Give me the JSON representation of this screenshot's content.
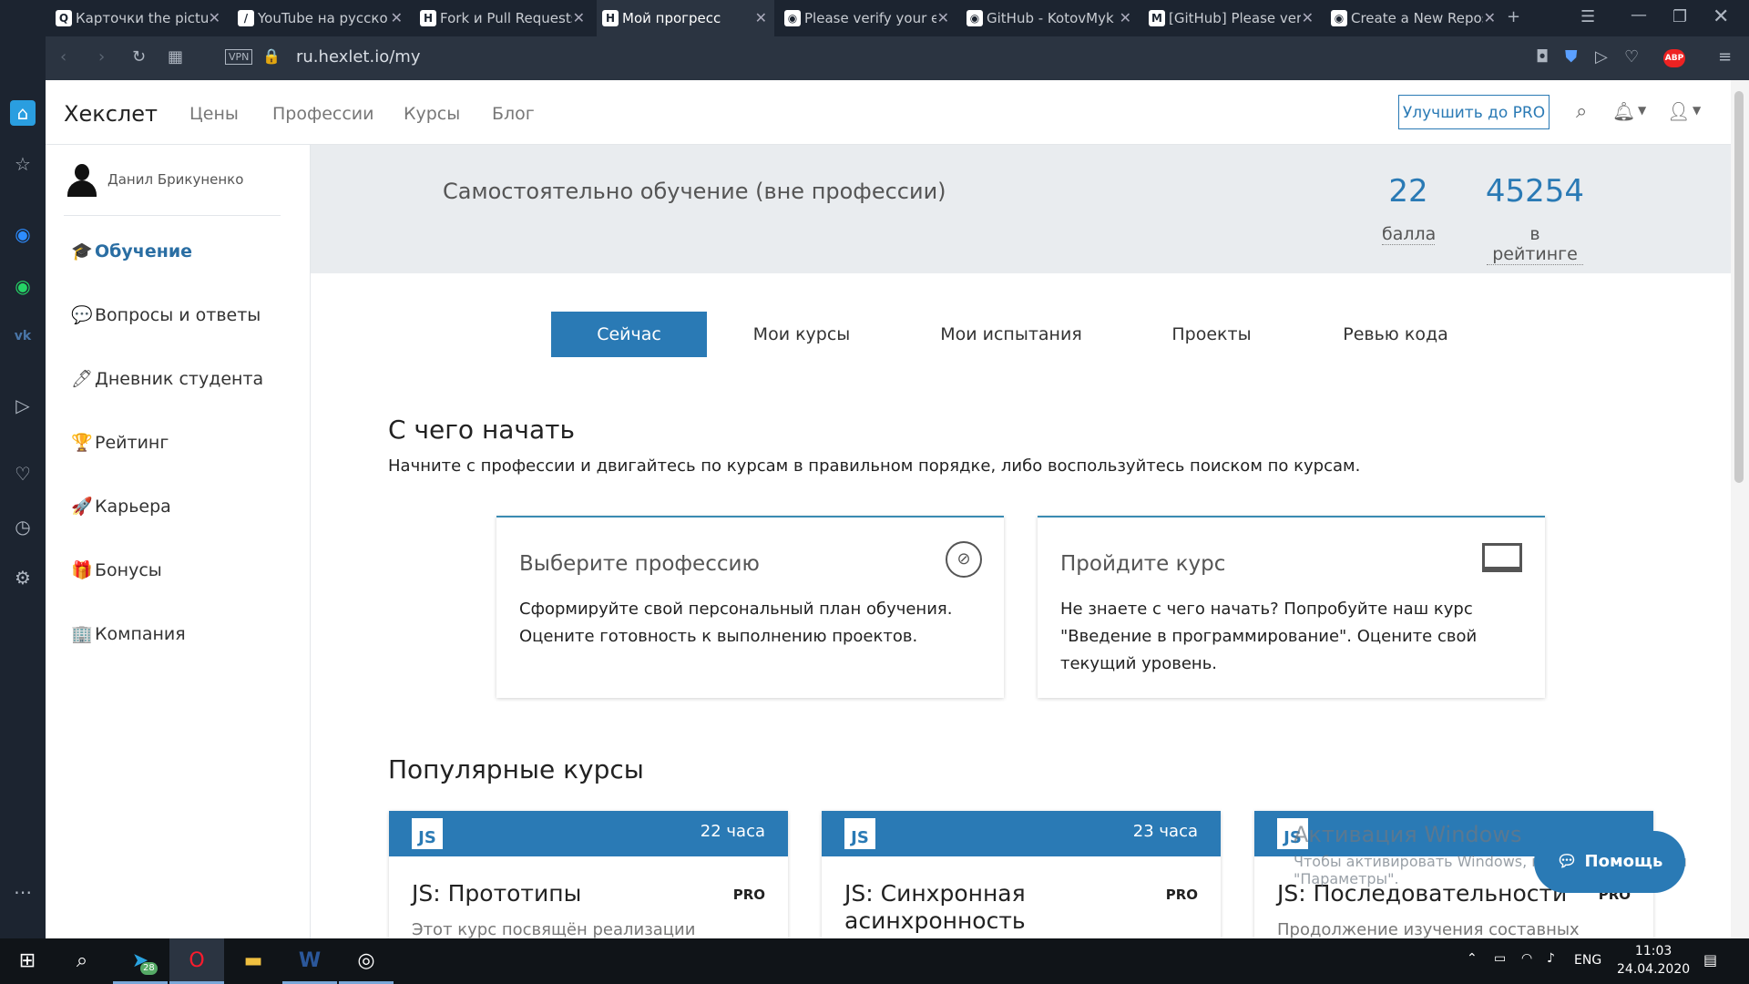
{
  "browser": {
    "tabs": [
      {
        "label": "Карточки the pictur",
        "icon": "Q"
      },
      {
        "label": "YouTube на русско",
        "icon": "/"
      },
      {
        "label": "Fork и Pull Requests",
        "icon": "H"
      },
      {
        "label": "Мой прогресс",
        "icon": "H"
      },
      {
        "label": "Please verify your er",
        "icon": "◉"
      },
      {
        "label": "GitHub - KotovMyk",
        "icon": "◉"
      },
      {
        "label": "[GitHub] Please veri",
        "icon": "M"
      },
      {
        "label": "Create a New Repos",
        "icon": "◉"
      }
    ],
    "vpn_label": "VPN",
    "url": "ru.hexlet.io/my",
    "abp_label": "ABP"
  },
  "site": {
    "logo": "Хекслет",
    "nav": [
      "Цены",
      "Профессии",
      "Курсы",
      "Блог"
    ],
    "pro_button": "Улучшить до PRO"
  },
  "sidebar": {
    "user_name": "Данил Брикуненко",
    "items": [
      {
        "label": "Обучение",
        "icon": "🎓"
      },
      {
        "label": "Вопросы и ответы",
        "icon": "💬"
      },
      {
        "label": "Дневник студента",
        "icon": "🖊"
      },
      {
        "label": "Рейтинг",
        "icon": "🏆"
      },
      {
        "label": "Карьера",
        "icon": "🚀"
      },
      {
        "label": "Бонусы",
        "icon": "🎁"
      },
      {
        "label": "Компания",
        "icon": "🏢"
      }
    ]
  },
  "banner": {
    "title": "Самостоятельно обучение (вне профессии)",
    "points_value": "22",
    "points_label": "балла",
    "rank_value": "45254",
    "rank_label": "в рейтинге"
  },
  "tabs": [
    "Сейчас",
    "Мои курсы",
    "Мои испытания",
    "Проекты",
    "Ревью кода"
  ],
  "start": {
    "title": "С чего начать",
    "description": "Начните с профессии и двигайтесь по курсам в правильном порядке, либо воспользуйтесь поиском по курсам.",
    "cards": [
      {
        "title": "Выберите профессию",
        "line1": "Сформируйте свой персональный план обучения.",
        "line2": "Оцените готовность к выполнению проектов.",
        "line3": ""
      },
      {
        "title": "Пройдите курс",
        "line1": "Не знаете с чего начать? Попробуйте наш курс",
        "line2": "\"Введение в программирование\". Оцените свой",
        "line3": "текущий уровень."
      }
    ]
  },
  "popular": {
    "title": "Популярные курсы",
    "courses": [
      {
        "badge": "JS",
        "hours": "22 часа",
        "title": "JS: Прототипы",
        "pro": "PRO",
        "desc": "Этот курс посвящён реализации"
      },
      {
        "badge": "JS",
        "hours": "23 часа",
        "title": "JS: Синхронная асинхронность",
        "pro": "PRO",
        "desc": ""
      },
      {
        "badge": "JS",
        "hours": "",
        "title": "JS: Последовательности",
        "pro": "PRO",
        "desc": "Продолжение изучения составных"
      }
    ]
  },
  "help_button": "Помощь",
  "windows_watermark": {
    "title": "Активация Windows",
    "subtitle": "Чтобы активировать Windows, перейдите в раздел \"Параметры\"."
  },
  "taskbar": {
    "telegram_badge": "28",
    "lang": "ENG",
    "time": "11:03",
    "date": "24.04.2020"
  }
}
